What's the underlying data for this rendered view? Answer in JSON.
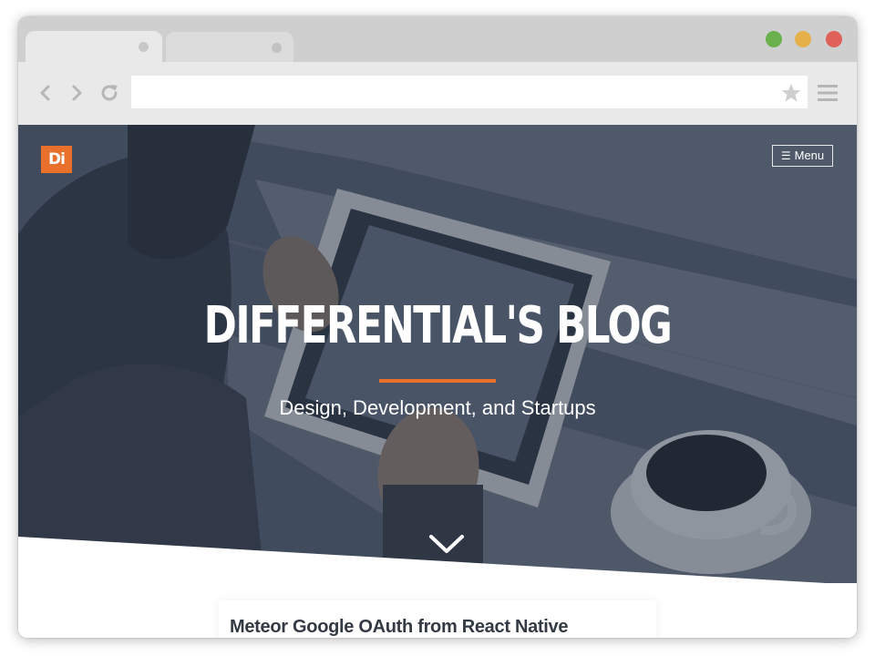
{
  "browser": {
    "traffic_colors": {
      "green": "#6ab04c",
      "yellow": "#e5b04a",
      "red": "#e0605a"
    },
    "url": "",
    "icons": {
      "back": "chevron-left-icon",
      "forward": "chevron-right-icon",
      "reload": "reload-icon",
      "bookmark": "star-icon",
      "menu": "hamburger-icon"
    }
  },
  "site": {
    "logo_text": "Di",
    "menu_label": "Menu",
    "hero": {
      "title": "DIFFERENTIAL'S BLOG",
      "subtitle": "Design, Development, and Startups"
    },
    "accent_color": "#e8702a",
    "posts": [
      {
        "title": "Meteor Google OAuth from React Native"
      }
    ]
  }
}
